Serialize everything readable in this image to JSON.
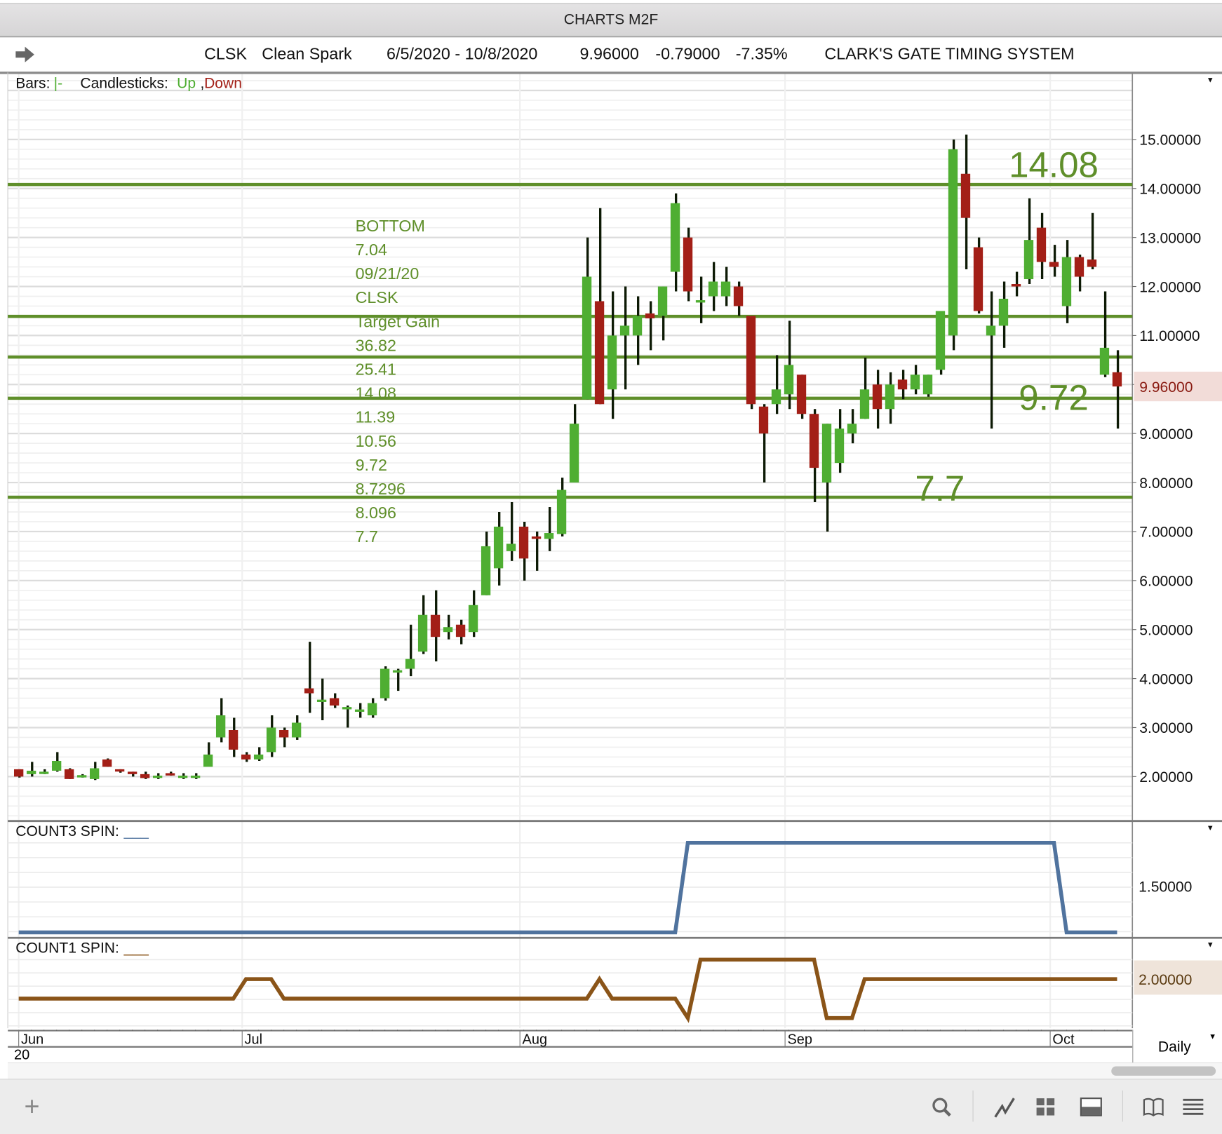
{
  "window": {
    "title": "CHARTS M2F"
  },
  "info": {
    "symbol": "CLSK",
    "name": "Clean Spark",
    "range": "6/5/2020 - 10/8/2020",
    "last": "9.96000",
    "change": "-0.79000",
    "pct": "-7.35%",
    "system": "CLARK'S GATE TIMING SYSTEM"
  },
  "legend": {
    "bars_label": "Bars:",
    "bars_glyph": "|-",
    "candles_label": "Candlesticks:",
    "up": "Up",
    "comma": ",",
    "down": "Down"
  },
  "colors": {
    "up": "#4fae32",
    "down": "#a31f17",
    "level": "#5f8f2a",
    "count3": "#50739e",
    "count1": "#8a5418",
    "text_green": "#5f8f2a"
  },
  "annotation_lines": [
    "BOTTOM",
    "7.04",
    "09/21/20",
    "CLSK",
    "Target Gain",
    "36.82",
    "25.41",
    "14.08",
    "11.39",
    "10.56",
    "9.72",
    "8.7296",
    "8.096",
    "7.7"
  ],
  "big_labels": [
    {
      "text": "14.08",
      "price": 14.55
    },
    {
      "text": "9.72",
      "price": 9.8
    },
    {
      "text": "7.7",
      "price": 7.95
    }
  ],
  "chart_data": {
    "type": "candlestick",
    "title": "CLSK Clean Spark",
    "ylim": [
      1.2,
      16.4
    ],
    "yticks": [
      "2.00000",
      "3.00000",
      "4.00000",
      "5.00000",
      "6.00000",
      "7.00000",
      "8.00000",
      "9.00000",
      "10.00000",
      "11.00000",
      "12.00000",
      "13.00000",
      "14.00000",
      "15.00000"
    ],
    "ytick_values": [
      2,
      3,
      4,
      5,
      6,
      7,
      8,
      9,
      10,
      11,
      12,
      13,
      14,
      15
    ],
    "last_price_label": "9.96000",
    "last_price": 9.96,
    "levels": [
      14.08,
      11.39,
      10.56,
      9.72,
      7.7
    ],
    "ohlc": [
      [
        2.15,
        2.15,
        1.98,
        2.0
      ],
      [
        2.05,
        2.3,
        2.0,
        2.12
      ],
      [
        2.1,
        2.15,
        2.05,
        2.1
      ],
      [
        2.12,
        2.5,
        2.1,
        2.32
      ],
      [
        2.15,
        2.17,
        1.95,
        1.95
      ],
      [
        2.03,
        2.05,
        1.98,
        2.03
      ],
      [
        1.95,
        2.3,
        1.93,
        2.17
      ],
      [
        2.35,
        2.37,
        2.2,
        2.2
      ],
      [
        2.15,
        2.15,
        2.08,
        2.12
      ],
      [
        2.1,
        2.1,
        2.0,
        2.05
      ],
      [
        2.05,
        2.1,
        1.95,
        1.97
      ],
      [
        2.02,
        2.07,
        1.95,
        2.02
      ],
      [
        2.07,
        2.1,
        2.02,
        2.03
      ],
      [
        2.0,
        2.07,
        1.95,
        2.02
      ],
      [
        2.0,
        2.07,
        1.95,
        2.02
      ],
      [
        2.2,
        2.7,
        2.25,
        2.45
      ],
      [
        2.8,
        3.6,
        2.7,
        3.25
      ],
      [
        2.95,
        3.2,
        2.4,
        2.55
      ],
      [
        2.45,
        2.5,
        2.3,
        2.35
      ],
      [
        2.35,
        2.6,
        2.32,
        2.45
      ],
      [
        2.5,
        3.25,
        2.4,
        3.0
      ],
      [
        2.95,
        3.0,
        2.6,
        2.8
      ],
      [
        2.8,
        3.25,
        2.75,
        3.1
      ],
      [
        3.8,
        4.75,
        3.3,
        3.7
      ],
      [
        3.55,
        4.0,
        3.15,
        3.57
      ],
      [
        3.6,
        3.7,
        3.4,
        3.45
      ],
      [
        3.4,
        3.45,
        3.0,
        3.42
      ],
      [
        3.35,
        3.5,
        3.2,
        3.37
      ],
      [
        3.25,
        3.6,
        3.2,
        3.5
      ],
      [
        3.6,
        4.25,
        3.55,
        4.2
      ],
      [
        4.15,
        4.2,
        3.75,
        4.17
      ],
      [
        4.2,
        5.1,
        4.05,
        4.4
      ],
      [
        4.55,
        5.7,
        4.5,
        5.3
      ],
      [
        5.3,
        5.8,
        4.35,
        4.85
      ],
      [
        4.95,
        5.3,
        4.8,
        5.05
      ],
      [
        5.1,
        5.2,
        4.7,
        4.85
      ],
      [
        4.95,
        5.8,
        4.85,
        5.5
      ],
      [
        5.7,
        7.0,
        5.7,
        6.7
      ],
      [
        6.25,
        7.4,
        5.9,
        7.1
      ],
      [
        6.6,
        7.6,
        6.4,
        6.75
      ],
      [
        7.1,
        7.2,
        6.0,
        6.45
      ],
      [
        6.9,
        7.0,
        6.2,
        6.85
      ],
      [
        6.85,
        7.5,
        6.6,
        6.97
      ],
      [
        6.95,
        8.1,
        6.9,
        7.85
      ],
      [
        8.0,
        9.6,
        8.0,
        9.2
      ],
      [
        9.7,
        13.0,
        9.7,
        12.2
      ],
      [
        11.7,
        13.6,
        9.6,
        9.6
      ],
      [
        9.9,
        11.9,
        9.3,
        11.0
      ],
      [
        11.0,
        12.0,
        9.9,
        11.2
      ],
      [
        11.0,
        11.8,
        10.4,
        11.4
      ],
      [
        11.45,
        11.7,
        10.7,
        11.35
      ],
      [
        11.4,
        12.0,
        10.9,
        12.0
      ],
      [
        12.3,
        13.9,
        11.9,
        13.7
      ],
      [
        13.0,
        13.2,
        11.7,
        11.9
      ],
      [
        11.68,
        12.2,
        11.25,
        11.72
      ],
      [
        11.8,
        12.5,
        11.5,
        12.1
      ],
      [
        11.8,
        12.4,
        11.6,
        12.1
      ],
      [
        12.0,
        12.1,
        11.4,
        11.6
      ],
      [
        11.4,
        11.4,
        9.5,
        9.6
      ],
      [
        9.55,
        9.6,
        8.0,
        9.0
      ],
      [
        9.6,
        10.6,
        9.4,
        9.9
      ],
      [
        9.8,
        11.3,
        9.5,
        10.4
      ],
      [
        10.2,
        10.2,
        9.3,
        9.4
      ],
      [
        9.4,
        9.5,
        7.6,
        8.3
      ],
      [
        8.0,
        9.2,
        7.0,
        9.2
      ],
      [
        8.4,
        9.5,
        8.2,
        9.1
      ],
      [
        9.0,
        9.5,
        8.8,
        9.2
      ],
      [
        9.3,
        10.55,
        9.3,
        9.9
      ],
      [
        10.0,
        10.3,
        9.1,
        9.5
      ],
      [
        9.5,
        10.25,
        9.2,
        10.0
      ],
      [
        10.1,
        10.3,
        9.7,
        9.9
      ],
      [
        9.9,
        10.4,
        9.8,
        10.2
      ],
      [
        9.8,
        10.2,
        9.75,
        10.2
      ],
      [
        10.3,
        11.5,
        10.2,
        11.5
      ],
      [
        11.0,
        15.0,
        10.7,
        14.8
      ],
      [
        14.3,
        15.1,
        12.35,
        13.4
      ],
      [
        12.8,
        13.0,
        11.45,
        11.5
      ],
      [
        11.0,
        11.9,
        9.1,
        11.2
      ],
      [
        11.2,
        12.1,
        10.75,
        11.75
      ],
      [
        12.05,
        12.3,
        11.8,
        12.0
      ],
      [
        12.15,
        13.8,
        12.05,
        12.95
      ],
      [
        13.2,
        13.5,
        12.15,
        12.5
      ],
      [
        12.5,
        12.85,
        12.2,
        12.4
      ],
      [
        11.6,
        12.95,
        11.25,
        12.6
      ],
      [
        12.6,
        12.65,
        11.9,
        12.2
      ],
      [
        12.55,
        13.5,
        12.35,
        12.4
      ],
      [
        10.2,
        11.9,
        10.15,
        10.75
      ],
      [
        10.25,
        10.7,
        9.1,
        9.96
      ]
    ],
    "xticks": [
      {
        "label": "Jun",
        "index": 0
      },
      {
        "label": "Jul",
        "index": 17.7
      },
      {
        "label": "Aug",
        "index": 39.7
      },
      {
        "label": "Sep",
        "index": 60.7
      },
      {
        "label": "Oct",
        "index": 81.7
      }
    ],
    "year_label": "20",
    "interval": "Daily"
  },
  "count3": {
    "label": "COUNT3 SPIN:",
    "swatch": "___",
    "tick": "1.50000",
    "ylim": [
      0.95,
      2.1
    ],
    "values_desc": "1 for bars 0-52, 2 for bars 53-82, 1 for bars 83-87",
    "segments": [
      [
        0,
        52,
        1
      ],
      [
        53,
        82,
        2
      ],
      [
        83,
        87,
        1
      ]
    ]
  },
  "count1": {
    "label": "COUNT1 SPIN:",
    "swatch": "___",
    "tick": "2.00000",
    "ylim": [
      -0.5,
      3.6
    ],
    "segments": [
      [
        0,
        17,
        1
      ],
      [
        18,
        20,
        2
      ],
      [
        21,
        45,
        1
      ],
      [
        46,
        46,
        2
      ],
      [
        47,
        52,
        1
      ],
      [
        53,
        53,
        0
      ],
      [
        54,
        63,
        3
      ],
      [
        64,
        66,
        0
      ],
      [
        67,
        87,
        2
      ]
    ]
  },
  "toolbar": {
    "add": "+"
  }
}
